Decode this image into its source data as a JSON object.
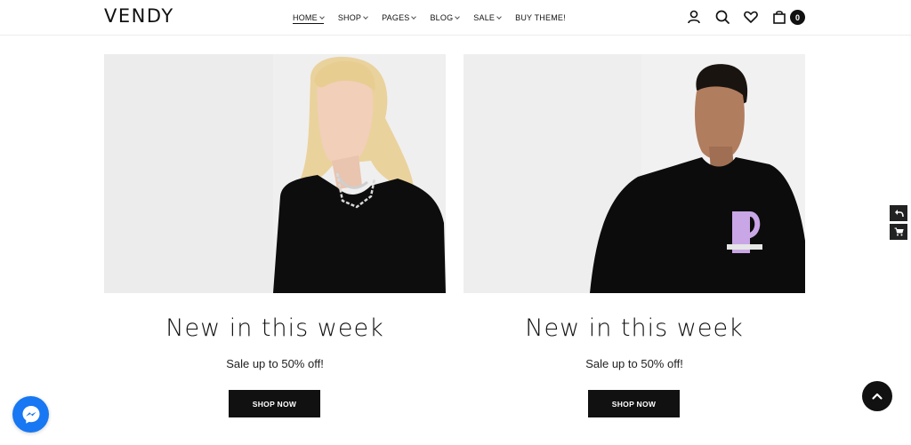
{
  "header": {
    "logo": "VENDY",
    "nav": [
      {
        "label": "HOME",
        "has_dropdown": true,
        "active": true
      },
      {
        "label": "SHOP",
        "has_dropdown": true
      },
      {
        "label": "PAGES",
        "has_dropdown": true
      },
      {
        "label": "BLOG",
        "has_dropdown": true
      },
      {
        "label": "SALE",
        "has_dropdown": true
      },
      {
        "label": "BUY THEME!",
        "has_dropdown": false
      }
    ],
    "icons": [
      "user-icon",
      "search-icon",
      "heart-icon",
      "bag-icon"
    ],
    "cart_count": "0"
  },
  "banners": [
    {
      "title": "New in this week",
      "subtitle": "Sale up to 50% off!",
      "button": "SHOP NOW",
      "model": "woman-black-tee"
    },
    {
      "title": "New in this week",
      "subtitle": "Sale up to 50% off!",
      "button": "SHOP NOW",
      "model": "man-black-tee"
    }
  ],
  "side_tools": [
    "undo-icon",
    "cart-icon"
  ],
  "floating": {
    "messenger": "messenger-icon",
    "scroll_top": "chevron-up-icon"
  },
  "colors": {
    "brand": "#111111",
    "messenger": "#1877f2"
  }
}
